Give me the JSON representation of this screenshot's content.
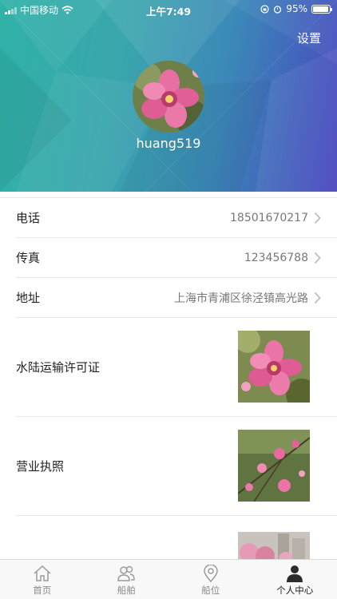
{
  "status_bar": {
    "carrier": "中国移动",
    "time": "上午7:49",
    "battery": "95%",
    "battery_level": 0.95
  },
  "header": {
    "settings_label": "设置",
    "username": "huang519"
  },
  "rows": [
    {
      "label": "电话",
      "value": "18501670217"
    },
    {
      "label": "传真",
      "value": "123456788"
    },
    {
      "label": "地址",
      "value": "上海市青浦区徐泾镇高光路"
    }
  ],
  "image_rows": [
    {
      "label": "水陆运输许可证"
    },
    {
      "label": "营业执照"
    },
    {
      "label": ""
    }
  ],
  "tabbar": {
    "tabs": [
      {
        "label": "首页",
        "icon": "home-icon"
      },
      {
        "label": "船舶",
        "icon": "ships-people-icon"
      },
      {
        "label": "船位",
        "icon": "location-pin-icon"
      },
      {
        "label": "个人中心",
        "icon": "person-icon",
        "active": true
      }
    ]
  },
  "colors": {
    "header_start": "#2fb2a7",
    "header_end": "#4a44c0",
    "divider": "#e6e6e6",
    "tab_inactive": "#8a8a8a"
  }
}
